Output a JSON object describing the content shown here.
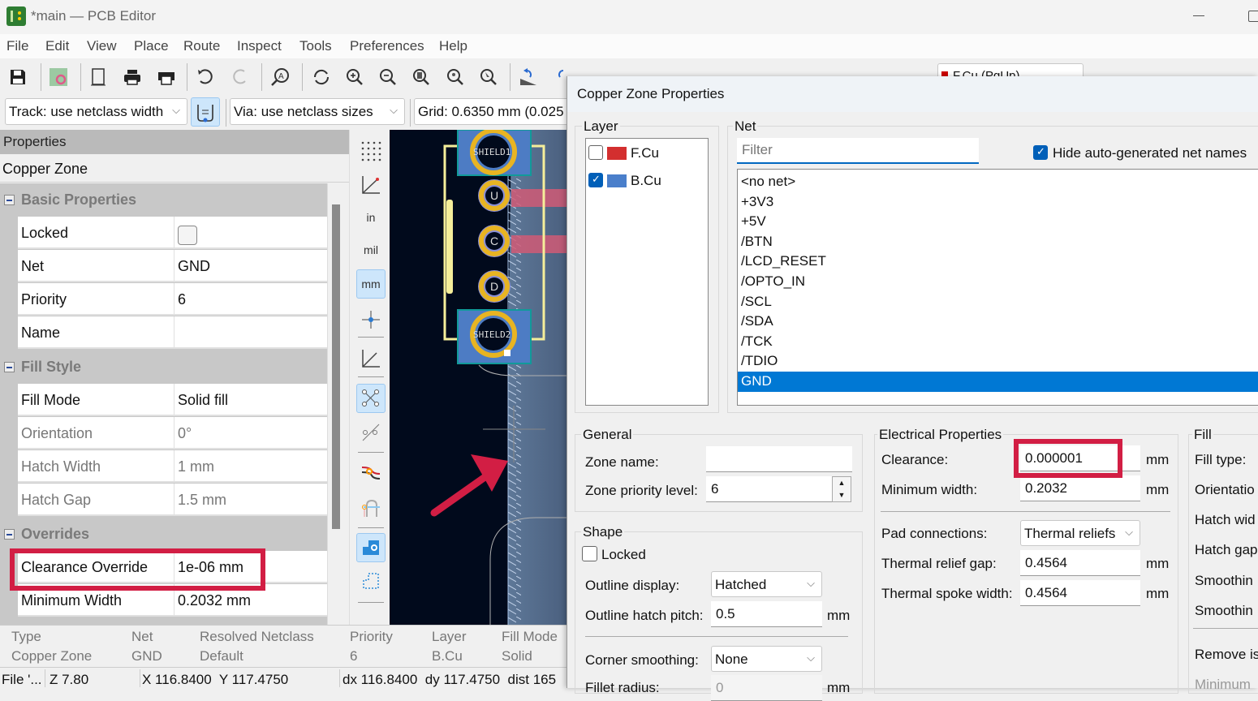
{
  "window": {
    "title": "*main — PCB Editor"
  },
  "menu": [
    "File",
    "Edit",
    "View",
    "Place",
    "Route",
    "Inspect",
    "Tools",
    "Preferences",
    "Help"
  ],
  "toolbar": {
    "icons": [
      "save-icon",
      "board-setup-icon",
      "page-settings-icon",
      "print-icon",
      "plot-icon",
      "undo-icon",
      "redo-icon",
      "find-icon",
      "refresh-icon",
      "zoom-in-icon",
      "zoom-out-icon",
      "zoom-fit-icon",
      "zoom-objects-icon",
      "zoom-selection-icon",
      "rotate-ccw-icon",
      "rotate-cw-icon",
      "flip-icon",
      "mirror-icon",
      "group-icon",
      "ungroup-icon",
      "lock-icon",
      "unlock-icon",
      "netlist-icon",
      "footprint-library-icon",
      "scripting-icon",
      "drc-icon"
    ],
    "layer_select": "F.Cu (PgUp)"
  },
  "toolbar2": {
    "track": "Track: use netclass width",
    "via": "Via: use netclass sizes",
    "grid": "Grid: 0.6350 mm (0.025"
  },
  "properties": {
    "header": "Properties",
    "type": "Copper Zone",
    "sections": {
      "basic": "Basic Properties",
      "fill": "Fill Style",
      "overrides": "Overrides"
    },
    "basic_rows": [
      {
        "key": "Locked",
        "value": "",
        "checkbox": true,
        "checked": false
      },
      {
        "key": "Net",
        "value": "GND"
      },
      {
        "key": "Priority",
        "value": "6"
      },
      {
        "key": "Name",
        "value": ""
      }
    ],
    "fill_rows": [
      {
        "key": "Fill Mode",
        "value": "Solid fill",
        "dim": false
      },
      {
        "key": "Orientation",
        "value": "0°",
        "dim": true
      },
      {
        "key": "Hatch Width",
        "value": "1 mm",
        "dim": true
      },
      {
        "key": "Hatch Gap",
        "value": "1.5 mm",
        "dim": true
      }
    ],
    "override_rows": [
      {
        "key": "Clearance Override",
        "value": "1e-06 mm"
      },
      {
        "key": "Minimum Width",
        "value": "0.2032 mm"
      }
    ]
  },
  "canvas": {
    "pads": [
      "SHIELD1",
      "U",
      "C",
      "D",
      "SHIELD2"
    ],
    "colors": {
      "background": "#010a1c",
      "pad": "#e8b422",
      "bcu": "#4d7cc4",
      "fcu": "#d04f6b",
      "silk": "#f5ee9a"
    }
  },
  "bottom_info": {
    "columns": [
      {
        "label": "Type",
        "value": "Copper Zone"
      },
      {
        "label": "Net",
        "value": "GND"
      },
      {
        "label": "Resolved Netclass",
        "value": "Default"
      },
      {
        "label": "Priority",
        "value": "6"
      },
      {
        "label": "Layer",
        "value": "B.Cu"
      },
      {
        "label": "Fill Mode",
        "value": "Solid"
      }
    ]
  },
  "statusbar": {
    "file": "File '...",
    "zoom": "Z 7.80",
    "xy": "X 116.8400  Y 117.4750",
    "delta": "dx 116.8400  dy 117.4750  dist 165"
  },
  "dialog": {
    "title": "Copper Zone Properties",
    "layer_label": "Layer",
    "layers": [
      {
        "name": "F.Cu",
        "checked": false,
        "color": "#d32f2f"
      },
      {
        "name": "B.Cu",
        "checked": true,
        "color": "#4a7fcb"
      }
    ],
    "net_label": "Net",
    "filter_placeholder": "Filter",
    "hide_auto_label": "Hide auto-generated net names",
    "hide_auto_checked": true,
    "nets": [
      "<no net>",
      "+3V3",
      "+5V",
      "/BTN",
      "/LCD_RESET",
      "/OPTO_IN",
      "/SCL",
      "/SDA",
      "/TCK",
      "/TDIO",
      "GND"
    ],
    "selected_net": "GND",
    "general": {
      "title": "General",
      "zone_name_label": "Zone name:",
      "zone_name_value": "",
      "priority_label": "Zone priority level:",
      "priority_value": "6"
    },
    "shape": {
      "title": "Shape",
      "locked_label": "Locked",
      "outline_display_label": "Outline display:",
      "outline_display_value": "Hatched",
      "hatch_pitch_label": "Outline hatch pitch:",
      "hatch_pitch_value": "0.5",
      "hatch_pitch_unit": "mm",
      "corner_smoothing_label": "Corner smoothing:",
      "corner_smoothing_value": "None",
      "fillet_label": "Fillet radius:",
      "fillet_value": "0",
      "fillet_unit": "mm"
    },
    "electrical": {
      "title": "Electrical Properties",
      "clearance_label": "Clearance:",
      "clearance_value": "0.000001",
      "min_width_label": "Minimum width:",
      "min_width_value": "0.2032",
      "pad_conn_label": "Pad connections:",
      "pad_conn_value": "Thermal reliefs",
      "relief_gap_label": "Thermal relief gap:",
      "relief_gap_value": "0.4564",
      "spoke_width_label": "Thermal spoke width:",
      "spoke_width_value": "0.4564",
      "unit": "mm"
    },
    "fill": {
      "title": "Fill",
      "labels": [
        "Fill type:",
        "Orientatio",
        "Hatch wid",
        "Hatch gap",
        "Smoothin",
        "Smoothin",
        "Remove is",
        "Minimum"
      ]
    }
  }
}
